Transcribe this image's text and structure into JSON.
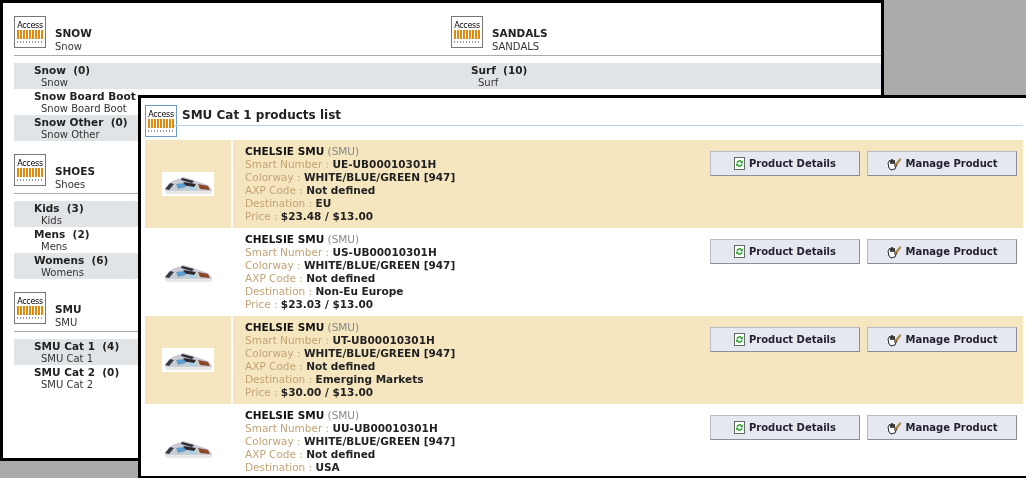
{
  "back_window": {
    "columns": [
      {
        "sections": [
          {
            "logo": "Access",
            "title": "SNOW",
            "subtitle": "Snow",
            "items": [
              {
                "name": "Snow  (0)",
                "subtitle": "Snow"
              },
              {
                "name": "Snow Board Boot",
                "subtitle": "Snow Board Boot"
              },
              {
                "name": "Snow Other  (0)",
                "subtitle": "Snow Other"
              }
            ]
          },
          {
            "logo": "Access",
            "title": "SHOES",
            "subtitle": "Shoes",
            "items": [
              {
                "name": "Kids  (3)",
                "subtitle": "Kids"
              },
              {
                "name": "Mens  (2)",
                "subtitle": "Mens"
              },
              {
                "name": "Womens  (6)",
                "subtitle": "Womens"
              }
            ]
          },
          {
            "logo": "Access",
            "title": "SMU",
            "subtitle": "SMU",
            "items": [
              {
                "name": "SMU Cat 1  (4)",
                "subtitle": "SMU Cat 1"
              },
              {
                "name": "SMU Cat 2  (0)",
                "subtitle": "SMU Cat 2"
              }
            ]
          }
        ]
      },
      {
        "sections": [
          {
            "logo": "Access",
            "title": "SANDALS",
            "subtitle": "SANDALS",
            "items": [
              {
                "name": "Surf  (10)",
                "subtitle": "Surf"
              }
            ]
          }
        ]
      }
    ]
  },
  "products_window": {
    "logo": "Access",
    "title": "SMU Cat 1 products list",
    "rows": [
      {
        "kind": "picture",
        "heading": "**CHELSIE SMU** (SMU)",
        "fields": [
          "Smart Number : **UE-UB00010301H**",
          "Colorway : **WHITE/BLUE/GREEN [947]**",
          "AXP Code : **Not defined**",
          "Destination : **EU**",
          "Price : **$23.48 / $13.00**"
        ],
        "buttons": [
          {
            "kind": "details",
            "label": "Product Details"
          },
          {
            "kind": "manage",
            "label": "Manage Product"
          }
        ]
      },
      {
        "kind": "picture",
        "heading": "**CHELSIE SMU** (SMU)",
        "fields": [
          "Smart Number : **US-UB00010301H**",
          "Colorway : **WHITE/BLUE/GREEN [947]**",
          "AXP Code : **Not defined**",
          "Destination : **Non-Eu Europe**",
          "Price : **$23.03 / $13.00**"
        ],
        "buttons": [
          {
            "kind": "details",
            "label": "Product Details"
          },
          {
            "kind": "manage",
            "label": "Manage Product"
          }
        ]
      },
      {
        "kind": "picture",
        "heading": "**CHELSIE SMU** (SMU)",
        "fields": [
          "Smart Number : **UT-UB00010301H**",
          "Colorway : **WHITE/BLUE/GREEN [947]**",
          "AXP Code : **Not defined**",
          "Destination : **Emerging Markets**",
          "Price : **$30.00 / $13.00**"
        ],
        "buttons": [
          {
            "kind": "details",
            "label": "Product Details"
          },
          {
            "kind": "manage",
            "label": "Manage Product"
          }
        ]
      },
      {
        "kind": "picture",
        "heading": "**CHELSIE SMU** (SMU)",
        "fields": [
          "Smart Number : **UU-UB00010301H**",
          "Colorway : **WHITE/BLUE/GREEN [947]**",
          "AXP Code : **Not defined**",
          "Destination : **USA**"
        ],
        "buttons": [
          {
            "kind": "details",
            "label": "Product Details"
          },
          {
            "kind": "manage",
            "label": "Manage Product"
          }
        ]
      }
    ]
  }
}
